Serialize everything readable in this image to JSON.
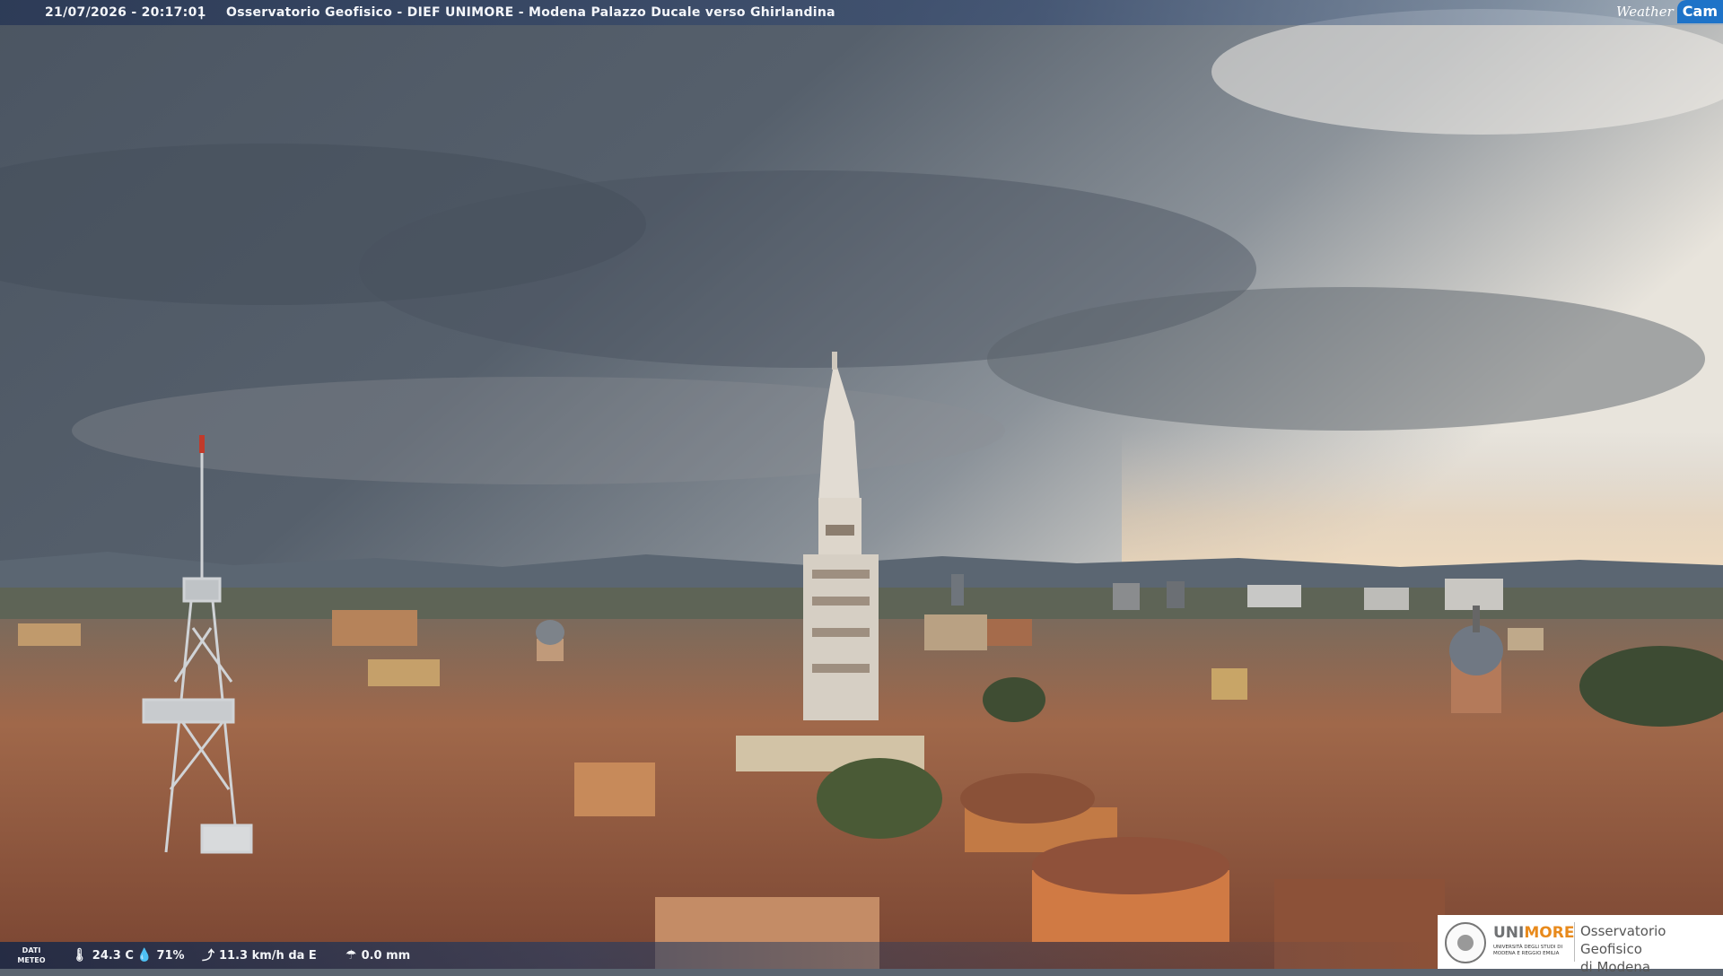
{
  "header": {
    "timestamp": "21/07/2026 - 20:17:01",
    "separator": "|",
    "title": "Osservatorio Geofisico - DIEF UNIMORE - Modena Palazzo Ducale verso Ghirlandina"
  },
  "brand": {
    "weathercam_word": "Weather",
    "weathercam_cam": "Cam"
  },
  "weather": {
    "label_line1": "DATI",
    "label_line2": "METEO",
    "temperature": "24.3 C",
    "humidity": "71%",
    "wind": "11.3 km/h da E",
    "rain": "0.0 mm",
    "icons": [
      "thermometer-icon",
      "humidity-drop-icon",
      "wind-icon",
      "rain-gauge-icon"
    ]
  },
  "institution": {
    "name_part1": "UNI",
    "name_part2": "MORE",
    "subtitle": "UNIVERSITÀ DEGLI STUDI DI MODENA E REGGIO EMILIA",
    "observatory_line1": "Osservatorio Geofisico",
    "observatory_line2": "di Modena"
  },
  "colors": {
    "sky_dark": "#4f5864",
    "sky_light": "#e9e4dc",
    "roofs": "#9a5a3e",
    "tower": "#dcd6cc",
    "accent_orange": "#e88a1c",
    "weathercam_blue": "#1e73c8"
  }
}
